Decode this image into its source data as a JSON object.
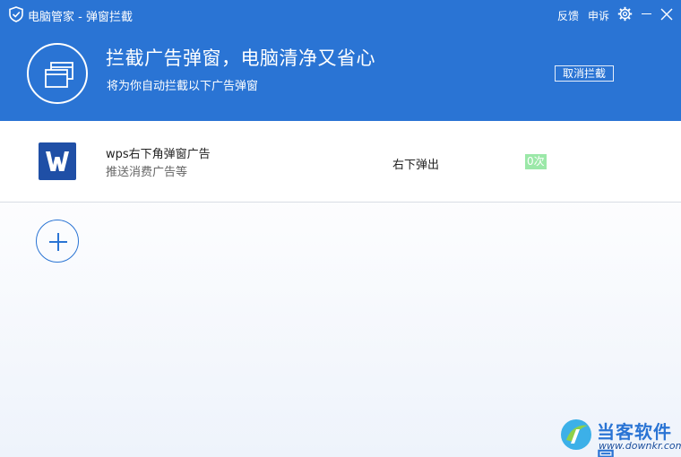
{
  "window": {
    "title": "电脑管家 - 弹窗拦截",
    "feedback_label": "反馈",
    "appeal_label": "申诉"
  },
  "banner": {
    "title": "拦截广告弹窗，电脑清净又省心",
    "subtitle": "将为你自动拦截以下广告弹窗",
    "cancel_label": "取消拦截"
  },
  "rules": [
    {
      "name": "wps右下角弹窗广告",
      "description": "推送消费广告等",
      "position": "右下弹出",
      "count": "0次",
      "icon": "wps-logo-icon"
    }
  ],
  "watermark": {
    "name": "当客软件园",
    "url": "www.downkr.com"
  },
  "colors": {
    "brand_blue": "#2a74d4",
    "count_badge": "#9be8a8",
    "wps_blue": "#1f4fa6"
  }
}
